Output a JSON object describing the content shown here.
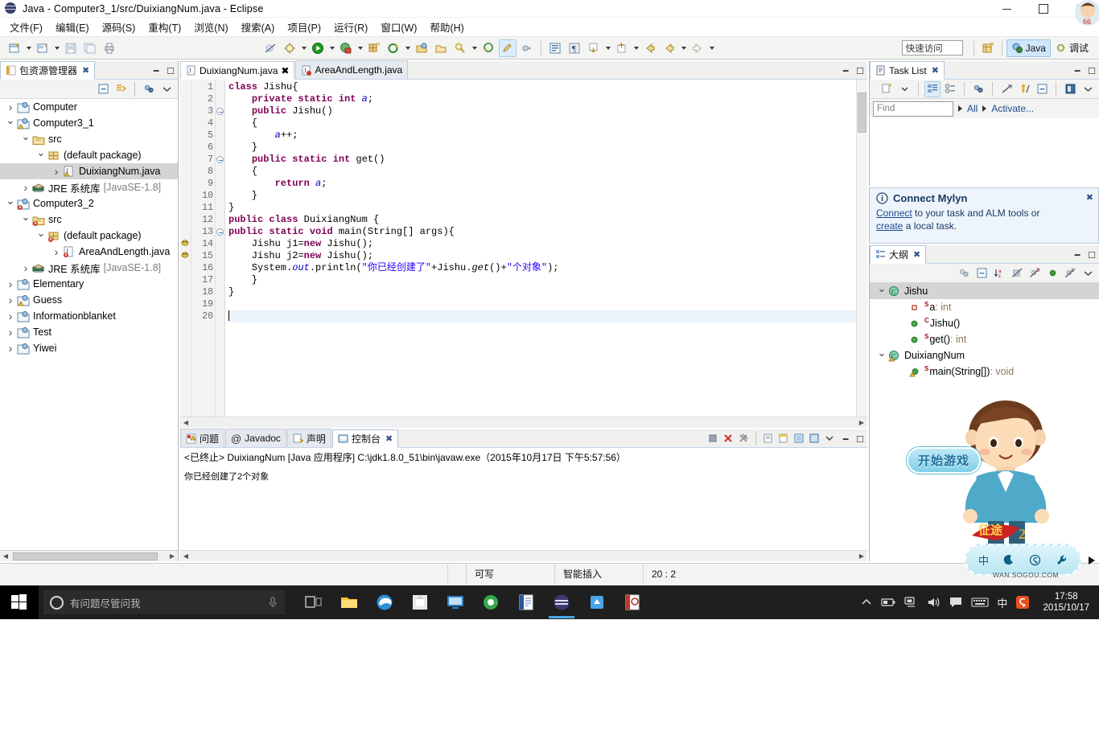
{
  "window": {
    "title": "Java - Computer3_1/src/DuixiangNum.java - Eclipse",
    "minimize": "–",
    "maximize": "□",
    "close": "✕"
  },
  "menubar": {
    "items": [
      {
        "label": "文件(F)"
      },
      {
        "label": "编辑(E)"
      },
      {
        "label": "源码(S)"
      },
      {
        "label": "重构(T)"
      },
      {
        "label": "浏览(N)"
      },
      {
        "label": "搜索(A)"
      },
      {
        "label": "项目(P)"
      },
      {
        "label": "运行(R)"
      },
      {
        "label": "窗口(W)"
      },
      {
        "label": "帮助(H)"
      }
    ]
  },
  "toolbar": {
    "quick_access_placeholder": "快速访问",
    "perspective_java": "Java",
    "perspective_debug": "调试",
    "icons": [
      "new-wizard-icon",
      "new-java-project-icon",
      "save-icon",
      "save-all-icon",
      "print-icon",
      "skip-breakpoints-icon",
      "debug-icon",
      "run-icon",
      "run-coverage-icon",
      "new-java-class-icon",
      "external-tools-icon",
      "search-icon",
      "open-type-icon",
      "open-task-icon",
      "last-edit-location-icon",
      "annotation-icon",
      "next-annotation-icon",
      "toggle-block-selection-icon",
      "toggle-whitespace-icon",
      "previous-edit-icon",
      "forward-edit-icon",
      "back-icon",
      "forward-icon"
    ]
  },
  "package_explorer": {
    "tab_label": "包资源管理器",
    "tree": [
      {
        "label": "Computer",
        "depth": 1,
        "state": "closed",
        "icon": "java-project-icon",
        "selected": false
      },
      {
        "label": "Computer3_1",
        "depth": 1,
        "state": "open",
        "icon": "java-project-warn-icon",
        "selected": false
      },
      {
        "label": "src",
        "depth": 2,
        "state": "open",
        "icon": "source-folder-icon",
        "selected": false
      },
      {
        "label": "(default package)",
        "depth": 3,
        "state": "open",
        "icon": "package-icon",
        "selected": false
      },
      {
        "label": "DuixiangNum.java",
        "depth": 4,
        "state": "closed",
        "icon": "java-file-warn-icon",
        "selected": true
      },
      {
        "label": "JRE 系统库",
        "depth": 2,
        "state": "closed",
        "icon": "jre-library-icon",
        "selected": false,
        "suffix": "[JavaSE-1.8]"
      },
      {
        "label": "Computer3_2",
        "depth": 1,
        "state": "open",
        "icon": "java-project-err-icon",
        "selected": false
      },
      {
        "label": "src",
        "depth": 2,
        "state": "open",
        "icon": "source-folder-err-icon",
        "selected": false
      },
      {
        "label": "(default package)",
        "depth": 3,
        "state": "open",
        "icon": "package-err-icon",
        "selected": false
      },
      {
        "label": "AreaAndLength.java",
        "depth": 4,
        "state": "closed",
        "icon": "java-file-err-icon",
        "selected": false
      },
      {
        "label": "JRE 系统库",
        "depth": 2,
        "state": "closed",
        "icon": "jre-library-icon",
        "selected": false,
        "suffix": "[JavaSE-1.8]"
      },
      {
        "label": "Elementary",
        "depth": 1,
        "state": "closed",
        "icon": "java-project-icon",
        "selected": false
      },
      {
        "label": "Guess",
        "depth": 1,
        "state": "closed",
        "icon": "java-project-warn-icon",
        "selected": false
      },
      {
        "label": "Informationblanket",
        "depth": 1,
        "state": "closed",
        "icon": "java-project-icon",
        "selected": false
      },
      {
        "label": "Test",
        "depth": 1,
        "state": "closed",
        "icon": "java-project-icon",
        "selected": false
      },
      {
        "label": "Yiwei",
        "depth": 1,
        "state": "closed",
        "icon": "java-project-icon",
        "selected": false
      }
    ]
  },
  "editor": {
    "tabs": [
      {
        "label": "DuixiangNum.java",
        "active": true,
        "closeable": true
      },
      {
        "label": "AreaAndLength.java",
        "active": false,
        "closeable": false
      }
    ],
    "lines": [
      {
        "n": 1,
        "fold": false,
        "marker": "",
        "html": "<span class=\"kw\">class</span> Jishu{"
      },
      {
        "n": 2,
        "fold": false,
        "marker": "",
        "html": "    <span class=\"kw\">private static int</span> <span class=\"fld\">a</span>;"
      },
      {
        "n": 3,
        "fold": true,
        "marker": "",
        "html": "    <span class=\"kw\">public</span> Jishu()"
      },
      {
        "n": 4,
        "fold": false,
        "marker": "",
        "html": "    {"
      },
      {
        "n": 5,
        "fold": false,
        "marker": "",
        "html": "        <span class=\"fld\">a</span>++;"
      },
      {
        "n": 6,
        "fold": false,
        "marker": "",
        "html": "    }"
      },
      {
        "n": 7,
        "fold": true,
        "marker": "",
        "html": "    <span class=\"kw\">public static int</span> get()"
      },
      {
        "n": 8,
        "fold": false,
        "marker": "",
        "html": "    {"
      },
      {
        "n": 9,
        "fold": false,
        "marker": "",
        "html": "        <span class=\"kw\">return</span> <span class=\"fld\">a</span>;"
      },
      {
        "n": 10,
        "fold": false,
        "marker": "",
        "html": "    }"
      },
      {
        "n": 11,
        "fold": false,
        "marker": "",
        "html": "}"
      },
      {
        "n": 12,
        "fold": false,
        "marker": "",
        "html": "<span class=\"kw\">public class</span> DuixiangNum {"
      },
      {
        "n": 13,
        "fold": true,
        "marker": "",
        "html": "<span class=\"kw\">public static void</span> main(String[] args){"
      },
      {
        "n": 14,
        "fold": false,
        "marker": "warn",
        "html": "    Jishu j1=<span class=\"kw\">new</span> Jishu();"
      },
      {
        "n": 15,
        "fold": false,
        "marker": "warn",
        "html": "    Jishu j2=<span class=\"kw\">new</span> Jishu();"
      },
      {
        "n": 16,
        "fold": false,
        "marker": "",
        "html": "    System.<span class=\"fld\">out</span>.println(<span class=\"str\">\"你已经创建了\"</span>+Jishu.<span class=\"stat\">get</span>()+<span class=\"str\">\"个对象\"</span>);"
      },
      {
        "n": 17,
        "fold": false,
        "marker": "",
        "html": "    }"
      },
      {
        "n": 18,
        "fold": false,
        "marker": "",
        "html": "}"
      },
      {
        "n": 19,
        "fold": false,
        "marker": "",
        "html": ""
      },
      {
        "n": 20,
        "fold": false,
        "marker": "",
        "html": "",
        "current": true
      }
    ]
  },
  "bottom_panel": {
    "tabs": [
      {
        "label": "问题",
        "icon": "problems-icon",
        "active": false,
        "closeable": false
      },
      {
        "label": "Javadoc",
        "icon": "javadoc-icon",
        "active": false,
        "closeable": false
      },
      {
        "label": "声明",
        "icon": "declaration-icon",
        "active": false,
        "closeable": false
      },
      {
        "label": "控制台",
        "icon": "console-icon",
        "active": true,
        "closeable": true
      }
    ],
    "console": {
      "header": "<已终止> DuixiangNum [Java 应用程序] C:\\jdk1.8.0_51\\bin\\javaw.exe（2015年10月17日 下午5:57:56）",
      "output": "你已经创建了2个对象"
    }
  },
  "task_list": {
    "tab_label": "Task List",
    "find_placeholder": "Find",
    "filter_all": "All",
    "filter_activate": "Activate..."
  },
  "mylyn": {
    "title": "Connect Mylyn",
    "link_connect": "Connect",
    "text_mid": " to your task and ALM tools or ",
    "link_create": "create",
    "text_end": " a local task."
  },
  "outline": {
    "tab_label": "大纲",
    "items": [
      {
        "label": "Jishu",
        "depth": 0,
        "state": "open",
        "icon": "class-icon",
        "sup": "",
        "selected": true,
        "type": ""
      },
      {
        "label": "a",
        "depth": 1,
        "state": "none",
        "icon": "field-private-icon",
        "sup": "S",
        "selected": false,
        "type": " : int"
      },
      {
        "label": "Jishu()",
        "depth": 1,
        "state": "none",
        "icon": "method-public-icon",
        "sup": "C",
        "selected": false,
        "type": ""
      },
      {
        "label": "get()",
        "depth": 1,
        "state": "none",
        "icon": "method-public-icon",
        "sup": "S",
        "selected": false,
        "type": " : int"
      },
      {
        "label": "DuixiangNum",
        "depth": 0,
        "state": "open",
        "icon": "class-warn-icon",
        "sup": "",
        "selected": false,
        "type": ""
      },
      {
        "label": "main(String[])",
        "depth": 1,
        "state": "none",
        "icon": "method-warn-icon",
        "sup": "S",
        "selected": false,
        "type": " : void"
      }
    ]
  },
  "statusbar": {
    "writable": "可写",
    "insert_mode": "智能插入",
    "position": "20 : 2"
  },
  "taskbar": {
    "search_placeholder": "有问题尽管问我",
    "clock_time": "17:58",
    "clock_date": "2015/10/17",
    "ime_indicator": "中",
    "apps": [
      {
        "name": "task-view-icon"
      },
      {
        "name": "file-explorer-icon"
      },
      {
        "name": "edge-browser-icon"
      },
      {
        "name": "store-icon"
      },
      {
        "name": "screen-app-icon"
      },
      {
        "name": "chrome-like-icon"
      },
      {
        "name": "word-icon"
      },
      {
        "name": "eclipse-icon"
      },
      {
        "name": "blue-app-icon"
      },
      {
        "name": "powerpoint-icon"
      }
    ]
  },
  "overlay": {
    "game_button": "开始游戏",
    "sogou_label": "WAN.SOGOU.COM",
    "sogou_icons": [
      "chinese-mode-icon",
      "moon-icon",
      "sogou-logo-icon",
      "wrench-icon"
    ]
  }
}
